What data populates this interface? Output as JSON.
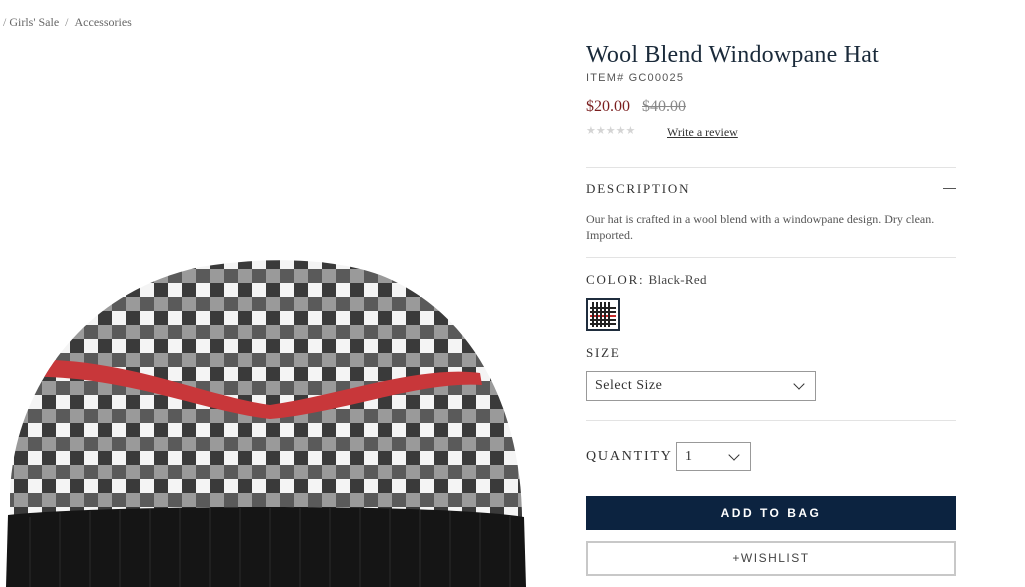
{
  "breadcrumb": {
    "items": [
      "Girls' Sale",
      "Accessories"
    ]
  },
  "product": {
    "title": "Wool Blend Windowpane Hat",
    "item_number": "ITEM# GC00025",
    "sale_price": "$20.00",
    "original_price": "$40.00",
    "rating_stars": "★★★★★",
    "rating_value": 0,
    "review_link": "Write a review",
    "image_icon": "knit-hat-photo"
  },
  "description": {
    "label": "DESCRIPTION",
    "text": "Our hat is crafted in a wool blend with a windowpane design. Dry clean. Imported."
  },
  "color": {
    "label": "COLOR:",
    "value": "Black-Red",
    "swatch_colors": [
      "#222222",
      "#ffffff",
      "#c52a2a"
    ]
  },
  "size": {
    "label": "SIZE",
    "placeholder": "Select Size"
  },
  "quantity": {
    "label": "QUANTITY",
    "value": "1"
  },
  "actions": {
    "add_to_bag": "ADD TO BAG",
    "wishlist": "+WISHLIST"
  },
  "colors": {
    "brand_navy": "#0c2340",
    "sale_red": "#7a1f1f"
  }
}
